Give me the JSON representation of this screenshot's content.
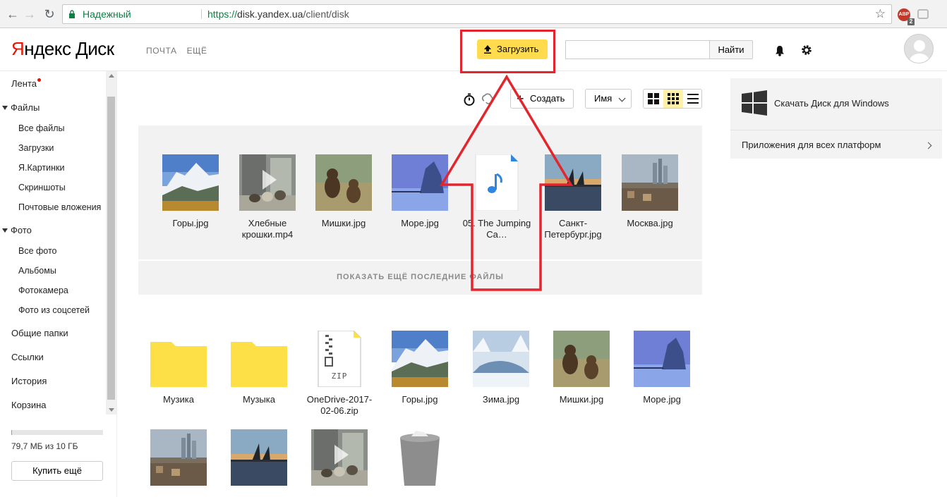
{
  "browser": {
    "secure_label": "Надежный",
    "url_scheme": "https://",
    "url_host": "disk.yandex.ua",
    "url_path": "/client/disk",
    "ext_abp_label": "ABP",
    "ext_abp_badge": "2"
  },
  "header": {
    "logo_ya_red": "Я",
    "logo_ya_rest": "ндекс",
    "logo_disk": "Диск",
    "nav": [
      "ПОЧТА",
      "ЕЩЁ"
    ],
    "upload_label": "Загрузить",
    "search_placeholder": "",
    "search_button": "Найти"
  },
  "sidebar": {
    "feed": "Лента",
    "files": "Файлы",
    "files_children": [
      "Все файлы",
      "Загрузки",
      "Я.Картинки",
      "Скриншоты",
      "Почтовые вложения"
    ],
    "photo": "Фото",
    "photo_children": [
      "Все фото",
      "Альбомы",
      "Фотокамера",
      "Фото из соцсетей"
    ],
    "shared": "Общие папки",
    "links": "Ссылки",
    "history": "История",
    "trash": "Корзина",
    "quota_text": "79,7 МБ из 10 ГБ",
    "quota_fraction": 0.008,
    "buy_button": "Купить ещё"
  },
  "toolbar": {
    "create_label": "Создать",
    "sort_label": "Имя"
  },
  "recent": {
    "files": [
      {
        "name": "Горы.jpg",
        "thumb": "mountains"
      },
      {
        "name": "Хлебные крошки.mp4",
        "thumb": "video-ducks"
      },
      {
        "name": "Мишки.jpg",
        "thumb": "bears"
      },
      {
        "name": "Море.jpg",
        "thumb": "sea"
      },
      {
        "name": "05. The Jumping Ca…",
        "thumb": "audio"
      },
      {
        "name": "Санкт-Петербург.jpg",
        "thumb": "spb"
      },
      {
        "name": "Москва.jpg",
        "thumb": "moscow"
      }
    ],
    "show_more": "ПОКАЗАТЬ ЕЩЁ ПОСЛЕДНИЕ ФАЙЛЫ"
  },
  "files": {
    "row1": [
      {
        "name": "Музика",
        "thumb": "folder"
      },
      {
        "name": "Музыка",
        "thumb": "folder"
      },
      {
        "name": "OneDrive-2017-02-06.zip",
        "thumb": "zip"
      },
      {
        "name": "Горы.jpg",
        "thumb": "mountains"
      },
      {
        "name": "Зима.jpg",
        "thumb": "winter"
      },
      {
        "name": "Мишки.jpg",
        "thumb": "bears"
      },
      {
        "name": "Море.jpg",
        "thumb": "sea"
      }
    ],
    "row2": [
      {
        "name": "",
        "thumb": "moscow"
      },
      {
        "name": "",
        "thumb": "spb"
      },
      {
        "name": "",
        "thumb": "video-ducks"
      },
      {
        "name": "",
        "thumb": "trash"
      }
    ],
    "zip_label": "ZIP"
  },
  "promo": {
    "windows_text": "Скачать Диск для Windows",
    "apps_text": "Приложения для всех платформ"
  },
  "colors": {
    "accent_yellow": "#ffdb4d",
    "annotation_red": "#e3262d",
    "folder_yellow": "#fde047",
    "brand_red": "#e61400"
  }
}
